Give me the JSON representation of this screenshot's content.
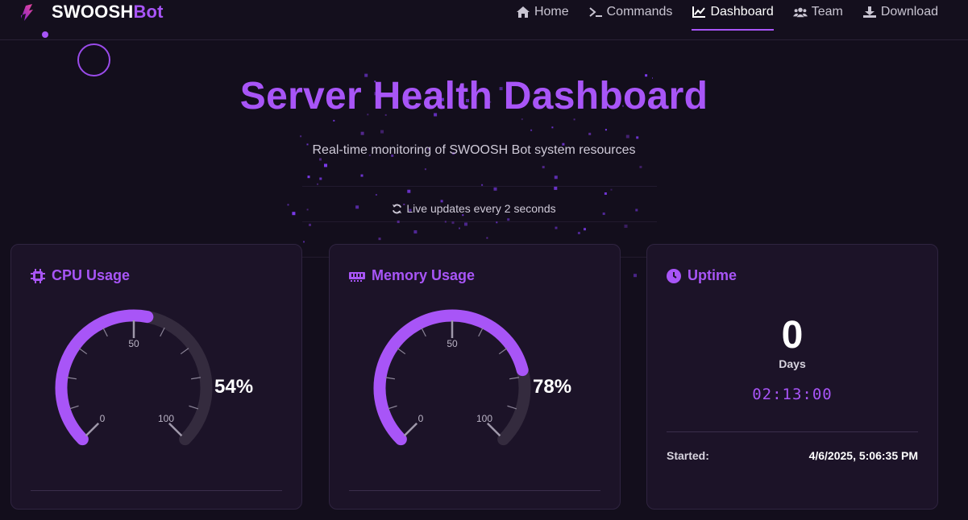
{
  "brand": {
    "name_main": "SWOOSH",
    "name_accent": "Bot"
  },
  "nav": [
    {
      "label": "Home",
      "icon": "home-icon"
    },
    {
      "label": "Commands",
      "icon": "terminal-icon"
    },
    {
      "label": "Dashboard",
      "icon": "chart-line-icon",
      "active": true
    },
    {
      "label": "Team",
      "icon": "users-icon"
    },
    {
      "label": "Download",
      "icon": "download-icon"
    }
  ],
  "hero": {
    "title": "Server Health Dashboard",
    "subtitle": "Real-time monitoring of SWOOSH Bot system resources",
    "live": "Live updates every 2 seconds"
  },
  "cards": {
    "cpu": {
      "title": "CPU Usage",
      "percent": "54%",
      "value": 54,
      "tick_min": "0",
      "tick_mid": "50",
      "tick_max": "100"
    },
    "memory": {
      "title": "Memory Usage",
      "percent": "78%",
      "value": 78,
      "tick_min": "0",
      "tick_mid": "50",
      "tick_max": "100"
    },
    "uptime": {
      "title": "Uptime",
      "days": "0",
      "days_label": "Days",
      "clock": "02:13:00",
      "started_label": "Started:",
      "started_value": "4/6/2025, 5:06:35 PM"
    }
  },
  "colors": {
    "accent": "#a855f7",
    "background": "#130e1c",
    "card": "#1c1328",
    "track": "#342b3e"
  }
}
